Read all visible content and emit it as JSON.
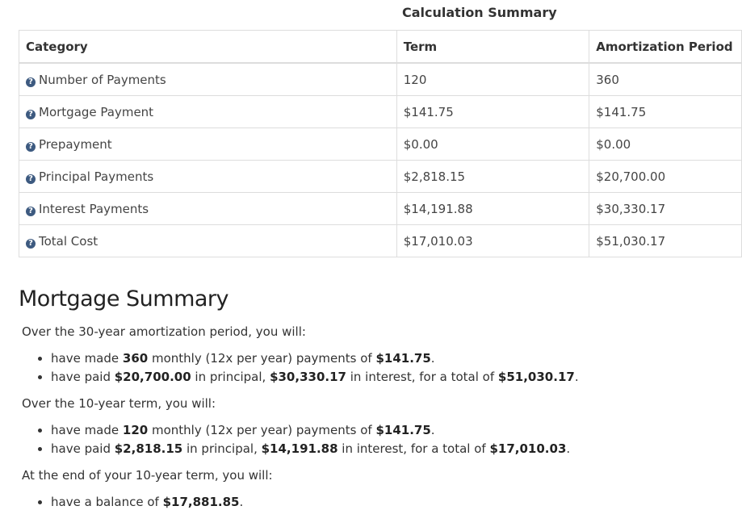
{
  "calculation_summary": {
    "title": "Calculation Summary",
    "headers": {
      "category": "Category",
      "term": "Term",
      "amortization": "Amortization Period"
    },
    "rows": [
      {
        "label": "Number of Payments",
        "term": "120",
        "amortization": "360"
      },
      {
        "label": "Mortgage Payment",
        "term": "$141.75",
        "amortization": "$141.75"
      },
      {
        "label": "Prepayment",
        "term": "$0.00",
        "amortization": "$0.00"
      },
      {
        "label": "Principal Payments",
        "term": "$2,818.15",
        "amortization": "$20,700.00"
      },
      {
        "label": "Interest Payments",
        "term": "$14,191.88",
        "amortization": "$30,330.17"
      },
      {
        "label": "Total Cost",
        "term": "$17,010.03",
        "amortization": "$51,030.17"
      }
    ],
    "info_icon": "question-circle-icon"
  },
  "mortgage_summary": {
    "title": "Mortgage Summary",
    "amortization": {
      "intro": "Over the 30-year amortization period, you will:",
      "payments": {
        "pre": "have made ",
        "count": "360",
        "mid": " monthly (12x per year) payments of ",
        "amount": "$141.75",
        "post": "."
      },
      "totals": {
        "pre": "have paid ",
        "principal": "$20,700.00",
        "mid1": " in principal, ",
        "interest": "$30,330.17",
        "mid2": " in interest, for a total of ",
        "total": "$51,030.17",
        "post": "."
      }
    },
    "term": {
      "intro": "Over the 10-year term, you will:",
      "payments": {
        "pre": "have made ",
        "count": "120",
        "mid": " monthly (12x per year) payments of ",
        "amount": "$141.75",
        "post": "."
      },
      "totals": {
        "pre": "have paid ",
        "principal": "$2,818.15",
        "mid1": " in principal, ",
        "interest": "$14,191.88",
        "mid2": " in interest, for a total of ",
        "total": "$17,010.03",
        "post": "."
      }
    },
    "end_of_term": {
      "intro": "At the end of your 10-year term, you will:",
      "balance": {
        "pre": "have a balance of ",
        "amount": "$17,881.85",
        "post": "."
      }
    }
  }
}
